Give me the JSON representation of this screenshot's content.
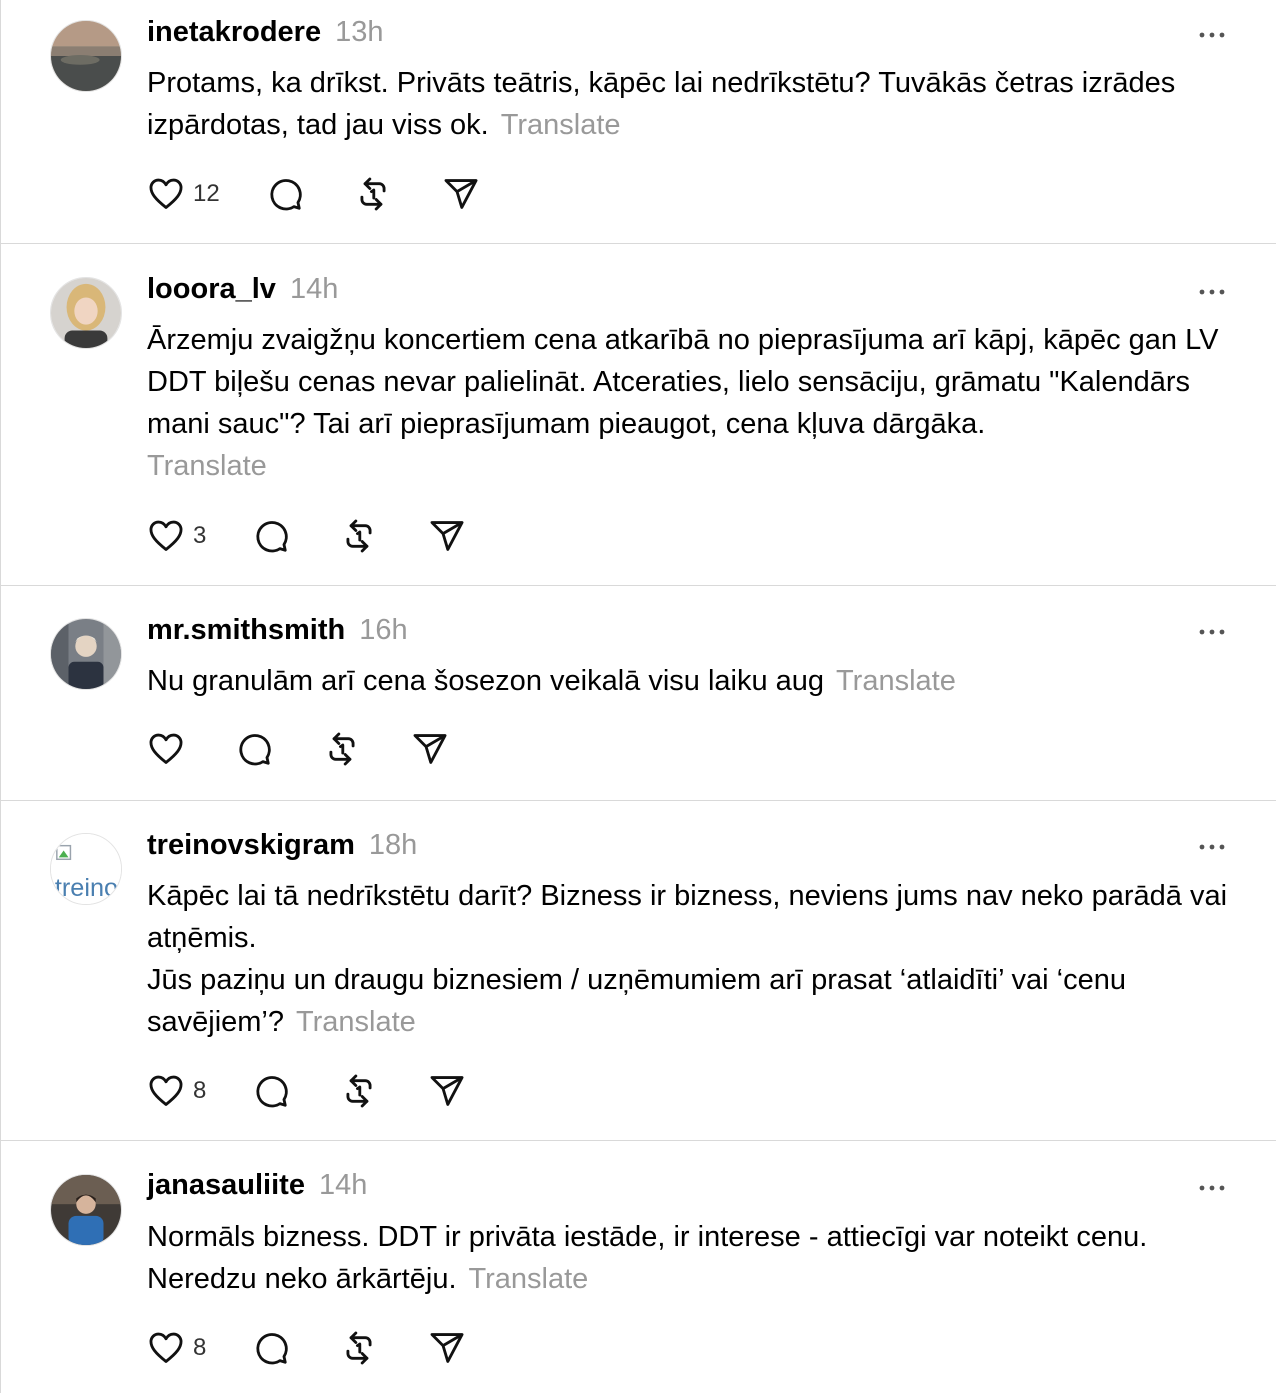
{
  "posts": [
    {
      "username": "inetakrodere",
      "time": "13h",
      "text": "Protams, ka drīkst. Privāts teātris, kāpēc lai nedrīkstētu? Tuvākās četras izrādes izpārdotas, tad jau viss ok.",
      "translate": "Translate",
      "likes": "12"
    },
    {
      "username": "looora_lv",
      "time": "14h",
      "text": "Ārzemju zvaigžņu koncertiem cena atkarībā no pieprasījuma arī kāpj, kāpēc gan LV DDT biļešu cenas nevar palielināt. Atceraties, lielo sensāciju, grāmatu \"Kalendārs mani sauc\"? Tai arī pieprasījumam pieaugot, cena kļuva dārgāka.",
      "translate": "Translate",
      "likes": "3"
    },
    {
      "username": "mr.smithsmith",
      "time": "16h",
      "text": "Nu granulām arī cena šosezon veikalā visu laiku aug",
      "translate": "Translate",
      "likes": ""
    },
    {
      "username": "treinovskigram",
      "time": "18h",
      "text_line1": "Kāpēc lai tā nedrīkstētu darīt? Bizness ir bizness, neviens jums nav neko parādā vai atņēmis.",
      "text_line2": "Jūs paziņu un draugu biznesiem / uzņēmumiem arī prasat ‘atlaidīti’ vai ‘cenu savējiem’?",
      "translate": "Translate",
      "likes": "8",
      "avatar_alt": "treinovskigram"
    },
    {
      "username": "janasauliite",
      "time": "14h",
      "text": "Normāls bizness. DDT ir privāta iestāde, ir interese - attiecīgi var noteikt cenu. Neredzu neko ārkārtēju.",
      "translate": "Translate",
      "likes": "8"
    }
  ],
  "icons": {
    "like": "heart-icon",
    "reply": "comment-icon",
    "repost": "repost-icon",
    "share": "send-icon",
    "more": "more-icon"
  },
  "colors": {
    "muted": "#999999",
    "divider": "#d9d9d9",
    "text": "#000000"
  }
}
